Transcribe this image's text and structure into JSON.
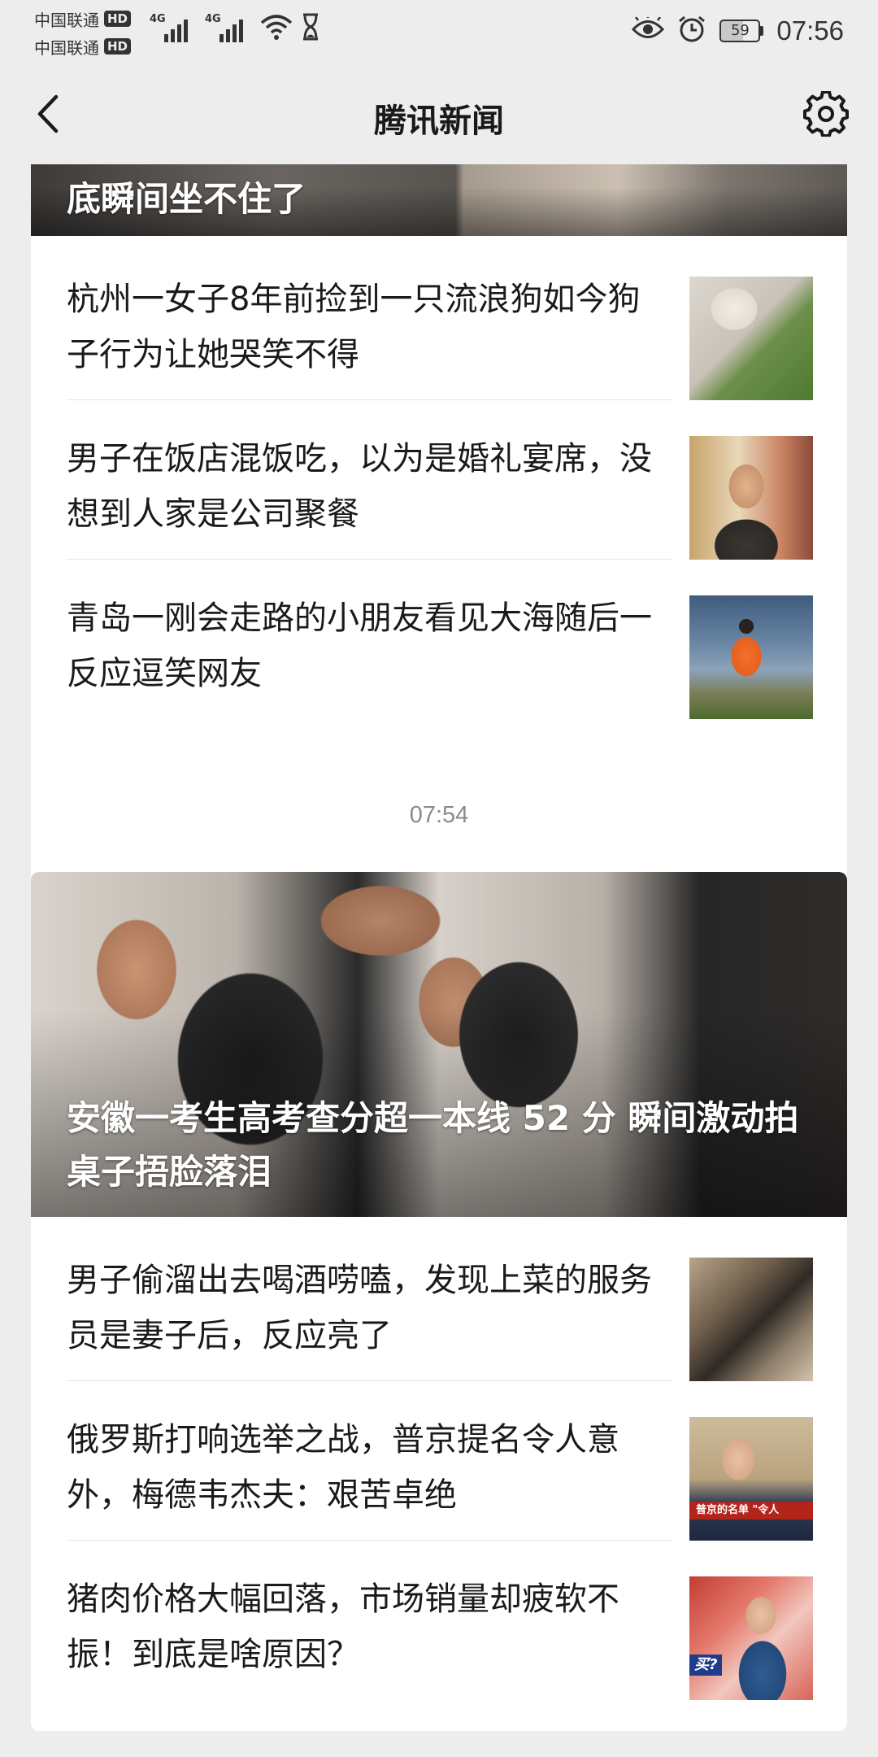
{
  "status_bar": {
    "carriers": [
      {
        "name": "中国联通",
        "badge": "HD"
      },
      {
        "name": "中国联通",
        "badge": "HD"
      }
    ],
    "network_labels": [
      "4G",
      "4G"
    ],
    "battery_level": "59",
    "battery_percent": 59,
    "time": "07:56"
  },
  "header": {
    "title": "腾讯新闻",
    "back_icon": "chevron-left-icon",
    "settings_icon": "gear-icon"
  },
  "feed": [
    {
      "hero_title": "底瞬间坐不住了",
      "items": [
        {
          "title": "杭州一女子8年前捡到一只流浪狗如今狗子行为让她哭笑不得"
        },
        {
          "title": "男子在饭店混饭吃，以为是婚礼宴席，没想到人家是公司聚餐"
        },
        {
          "title": "青岛一刚会走路的小朋友看见大海随后一反应逗笑网友"
        }
      ]
    },
    {
      "time": "07:54",
      "hero_title": "安徽一考生高考查分超一本线 52 分 瞬间激动拍桌子捂脸落泪",
      "items": [
        {
          "title": "男子偷溜出去喝酒唠嗑，发现上菜的服务员是妻子后，反应亮了"
        },
        {
          "title": "俄罗斯打响选举之战，普京提名令人意外，梅德韦杰夫：艰苦卓绝",
          "thumb_caption": "普京的名单 \"令人"
        },
        {
          "title": "猪肉价格大幅回落，市场销量却疲软不振！到底是啥原因？",
          "thumb_caption": "买?"
        }
      ]
    }
  ]
}
